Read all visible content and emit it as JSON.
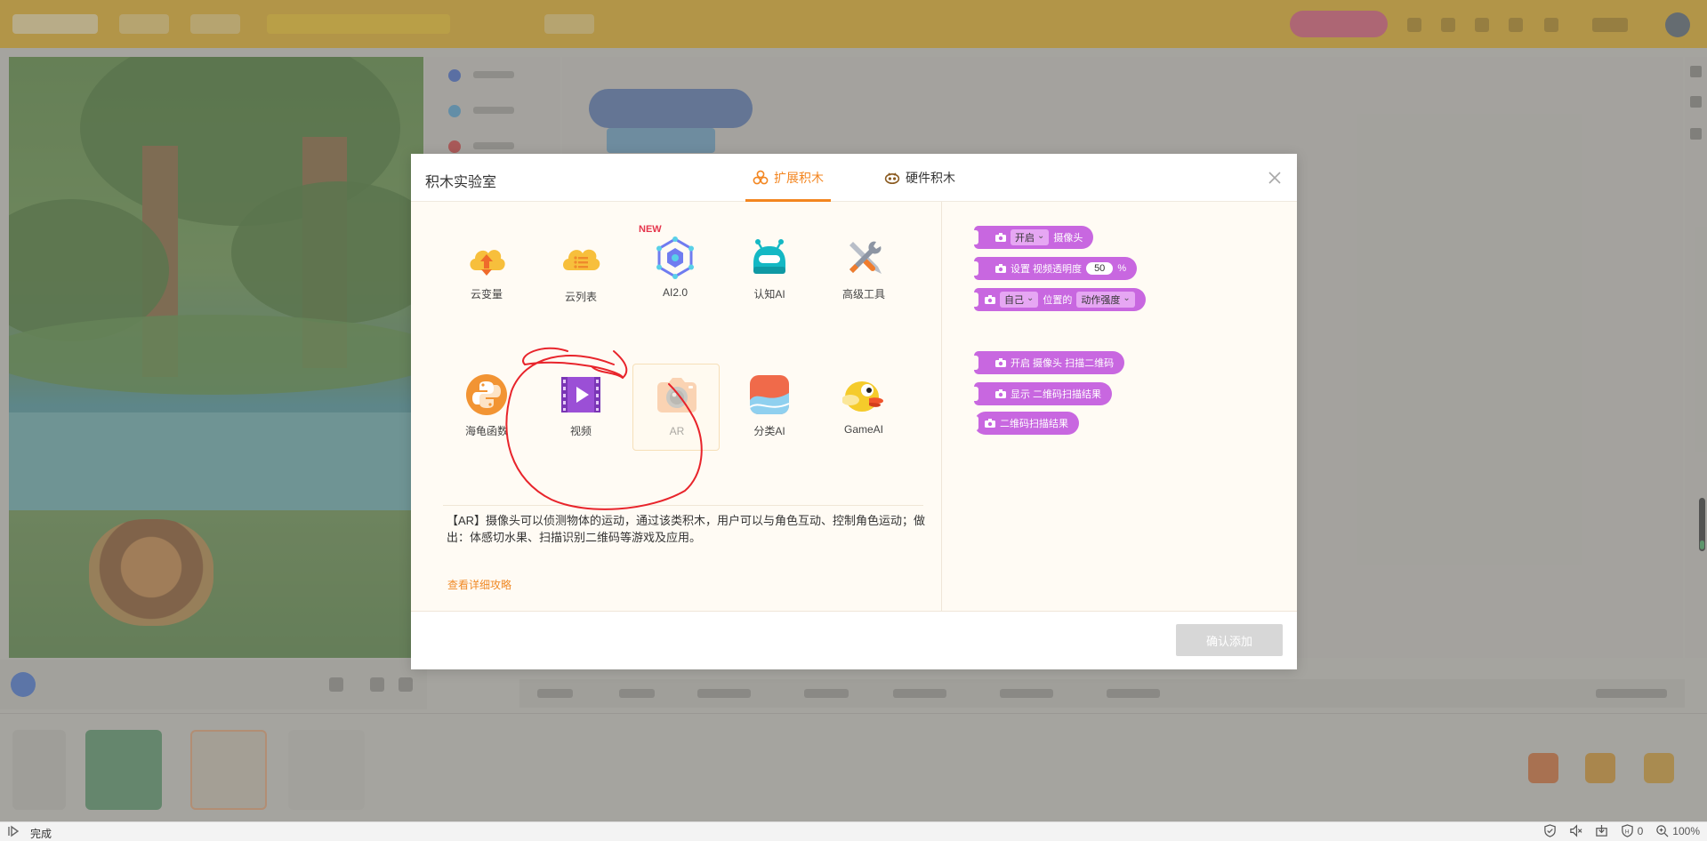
{
  "dialog": {
    "title": "积木实验室",
    "tabs": [
      {
        "label": "扩展积木",
        "active": true
      },
      {
        "label": "硬件积木",
        "active": false
      }
    ],
    "extensions": [
      {
        "label": "云变量",
        "icon": "cloud-variable-icon"
      },
      {
        "label": "云列表",
        "icon": "cloud-list-icon"
      },
      {
        "label": "AI2.0",
        "icon": "ai2-icon",
        "badge": "NEW"
      },
      {
        "label": "认知AI",
        "icon": "robot-icon"
      },
      {
        "label": "高级工具",
        "icon": "tools-icon"
      },
      {
        "label": "海龟函数",
        "icon": "python-icon"
      },
      {
        "label": "视频",
        "icon": "video-icon"
      },
      {
        "label": "AR",
        "icon": "camera-icon",
        "selected": true
      },
      {
        "label": "分类AI",
        "icon": "classify-ai-icon"
      },
      {
        "label": "GameAI",
        "icon": "bird-icon"
      }
    ],
    "description": "【AR】摄像头可以侦测物体的运动，通过该类积木，用户可以与角色互动、控制角色运动；做出：体感切水果、扫描识别二维码等游戏及应用。",
    "guide_link": "查看详细攻略",
    "confirm_label": "确认添加",
    "blocks": {
      "b1": {
        "dd": "开启",
        "text": "摄像头"
      },
      "b2": {
        "text": "设置 视频透明度",
        "num": "50",
        "unit": "%"
      },
      "b3": {
        "dd1": "自己",
        "text": "位置的",
        "dd2": "动作强度"
      },
      "b4": {
        "text": "开启 摄像头 扫描二维码"
      },
      "b5": {
        "text": "显示 二维码扫描结果"
      },
      "b6": {
        "text": "二维码扫描结果"
      }
    },
    "colors": {
      "accent": "#f3851f",
      "block": "#c867e0",
      "confirm_disabled": "#d7d7d7"
    }
  },
  "statusbar": {
    "text": "完成",
    "counter": "0",
    "zoom": "100%"
  }
}
